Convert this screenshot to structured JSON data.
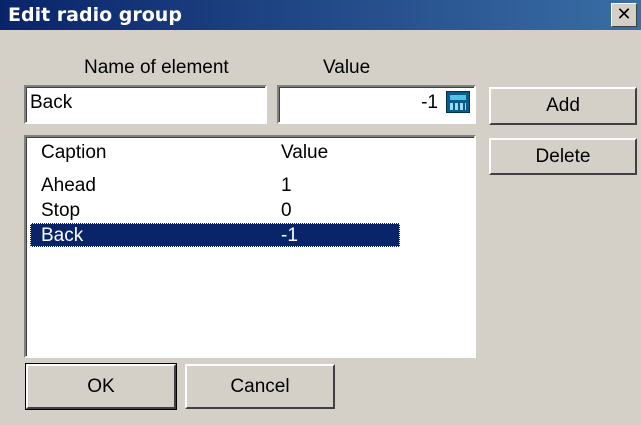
{
  "dialog": {
    "title": "Edit radio group",
    "close_glyph": "✕"
  },
  "labels": {
    "name_of_element": "Name of element",
    "value": "Value"
  },
  "inputs": {
    "name_value": "Back",
    "value_value": "-1"
  },
  "icons": {
    "calculator": "calculator-icon",
    "close": "close-icon"
  },
  "list": {
    "headers": {
      "caption": "Caption",
      "value": "Value"
    },
    "rows": [
      {
        "caption": "Ahead",
        "value": "1",
        "selected": false
      },
      {
        "caption": "Stop",
        "value": "0",
        "selected": false
      },
      {
        "caption": "Back",
        "value": "-1",
        "selected": true
      }
    ]
  },
  "buttons": {
    "add": "Add",
    "delete": "Delete",
    "ok": "OK",
    "cancel": "Cancel"
  },
  "colors": {
    "title_bar": "#0a246a",
    "selection": "#0a246a",
    "face": "#d4d0c8"
  }
}
